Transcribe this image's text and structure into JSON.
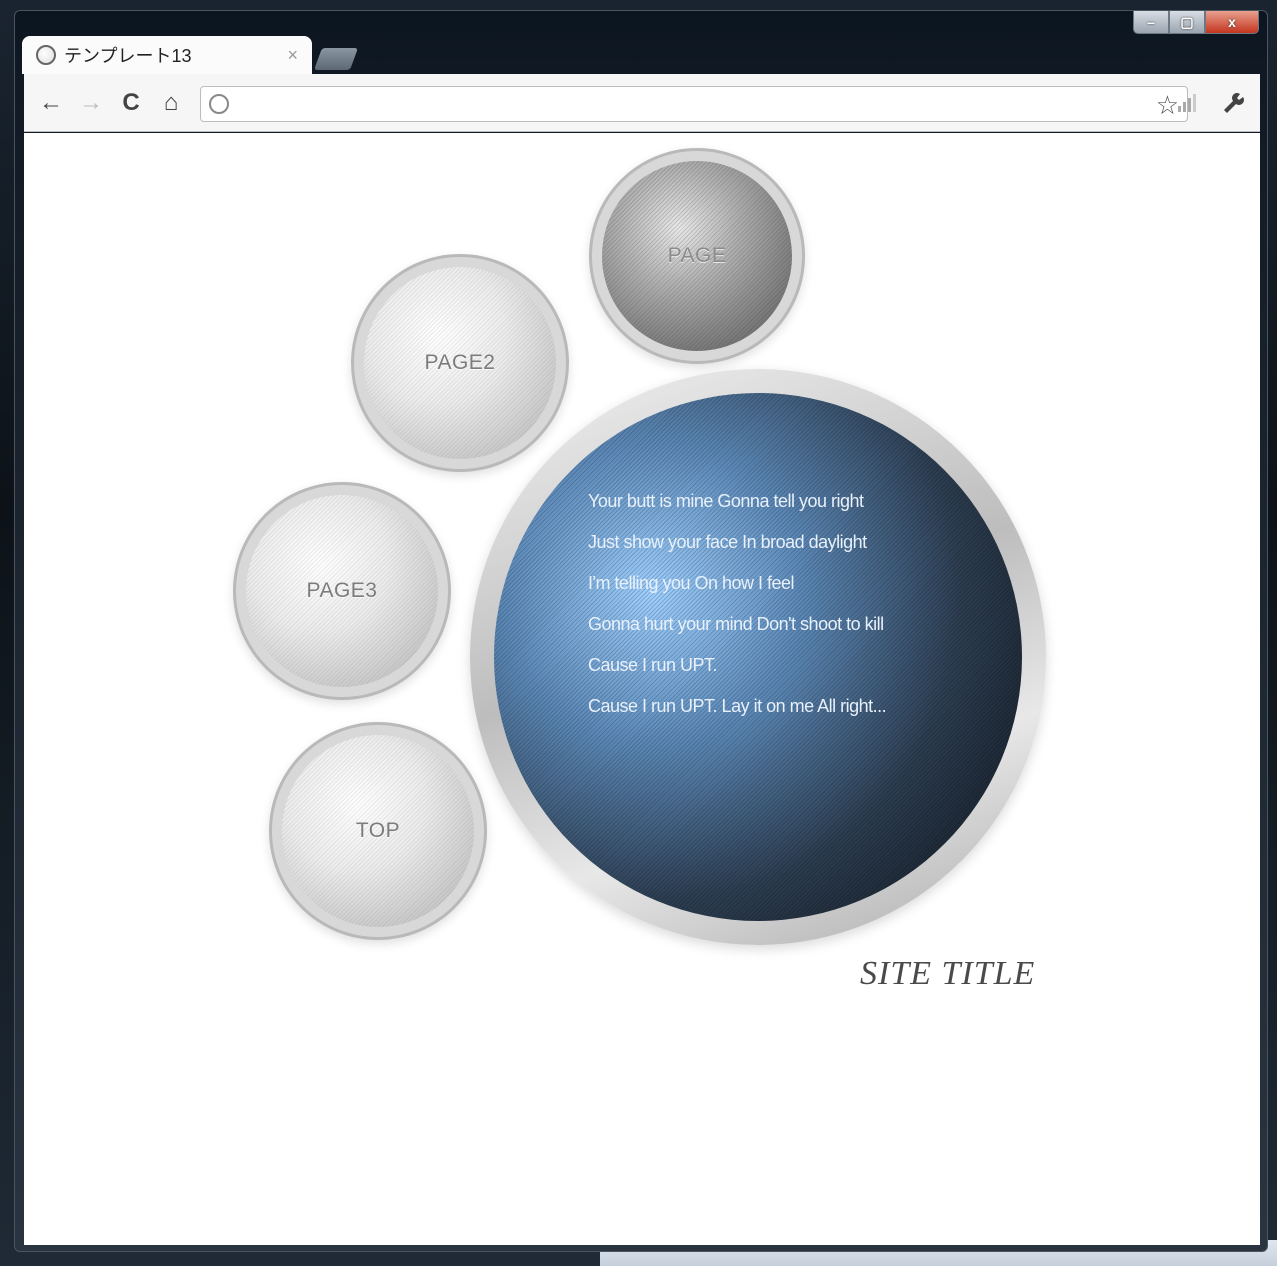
{
  "browser": {
    "tab_title": "テンプレート13",
    "tab_close": "×",
    "window_controls": {
      "minimize": "–",
      "maximize": "▢",
      "close": "x"
    },
    "toolbar": {
      "back_icon": "←",
      "forward_icon": "→",
      "reload_icon": "C",
      "home_icon": "⌂",
      "url": "",
      "star_icon": "☆",
      "wrench_icon": "🔧"
    }
  },
  "page": {
    "nav": [
      {
        "label": "PAGE",
        "name": "page"
      },
      {
        "label": "PAGE2",
        "name": "page2"
      },
      {
        "label": "PAGE3",
        "name": "page3"
      },
      {
        "label": "TOP",
        "name": "top"
      }
    ],
    "content_lines": [
      "Your butt is mine Gonna tell you right",
      "Just show your face In broad daylight",
      "I'm telling you On how I feel",
      "Gonna hurt your mind Don't shoot to kill",
      "Cause I run UPT.",
      "Cause I run UPT. Lay it on me All right..."
    ],
    "site_title": "SITE TITLE"
  }
}
